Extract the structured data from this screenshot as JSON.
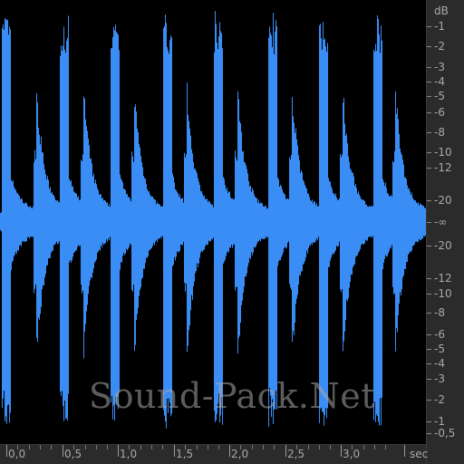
{
  "colors": {
    "background": "#000000",
    "waveform": "#3a8df5",
    "panel": "#2b2b2b",
    "label": "#a8a8a8"
  },
  "db_scale": {
    "unit": "dB",
    "labels_top": [
      "-1",
      "-2",
      "-3",
      "-4",
      "-5",
      "-6",
      "-8",
      "-10",
      "-12",
      "-20"
    ],
    "center": "-∞",
    "labels_bottom": [
      "-20",
      "-12",
      "-10",
      "-8",
      "-6",
      "-5",
      "-4",
      "-3",
      "-2",
      "-1",
      "-0,5"
    ]
  },
  "time_axis": {
    "labels": [
      "0,0",
      "0,5",
      "1,0",
      "1,5",
      "2,0",
      "2,5",
      "3,0"
    ],
    "unit": "sec"
  },
  "waveform": {
    "hit_count": 16
  },
  "watermark": "Sound-Pack.Net"
}
